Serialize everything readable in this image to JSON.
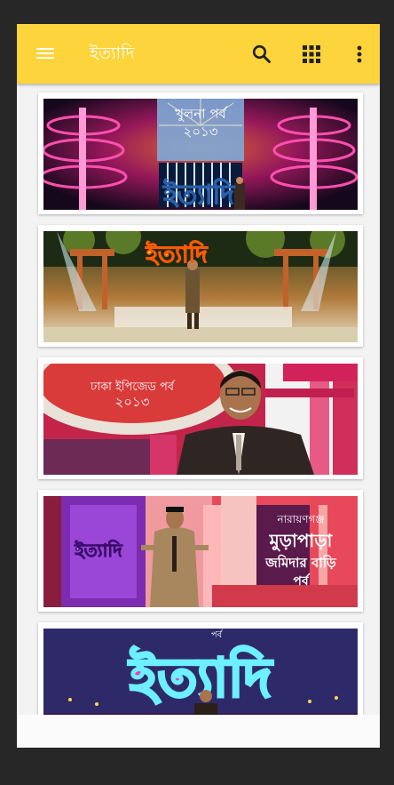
{
  "app": {
    "title": "ইত্যাদি",
    "accent_color": "#fdd43b"
  },
  "toolbar": {
    "menu_icon": "hamburger-menu-icon",
    "search_icon": "search-icon",
    "apps_icon": "grid-icon",
    "more_icon": "more-vertical-icon"
  },
  "episodes": [
    {
      "overlay_line1": "খুলনা পর্ব",
      "overlay_line2": "২০১৩",
      "overlay_line3": "ইত্যাদি"
    },
    {
      "overlay_line1": "ইত্যাদি"
    },
    {
      "overlay_line1": "ঢাকা ইপিজেড পর্ব",
      "overlay_line2": "২০১৩"
    },
    {
      "overlay_line1": "ইত্যাদি",
      "overlay_line2": "নারায়ণগঞ্জ",
      "overlay_line3": "মুড়াপাড়া",
      "overlay_line4": "জমিদার বাড়ি",
      "overlay_line5": "পর্ব"
    },
    {
      "overlay_line1": "পর্ব",
      "overlay_line2": "ইত্যাদি"
    }
  ]
}
